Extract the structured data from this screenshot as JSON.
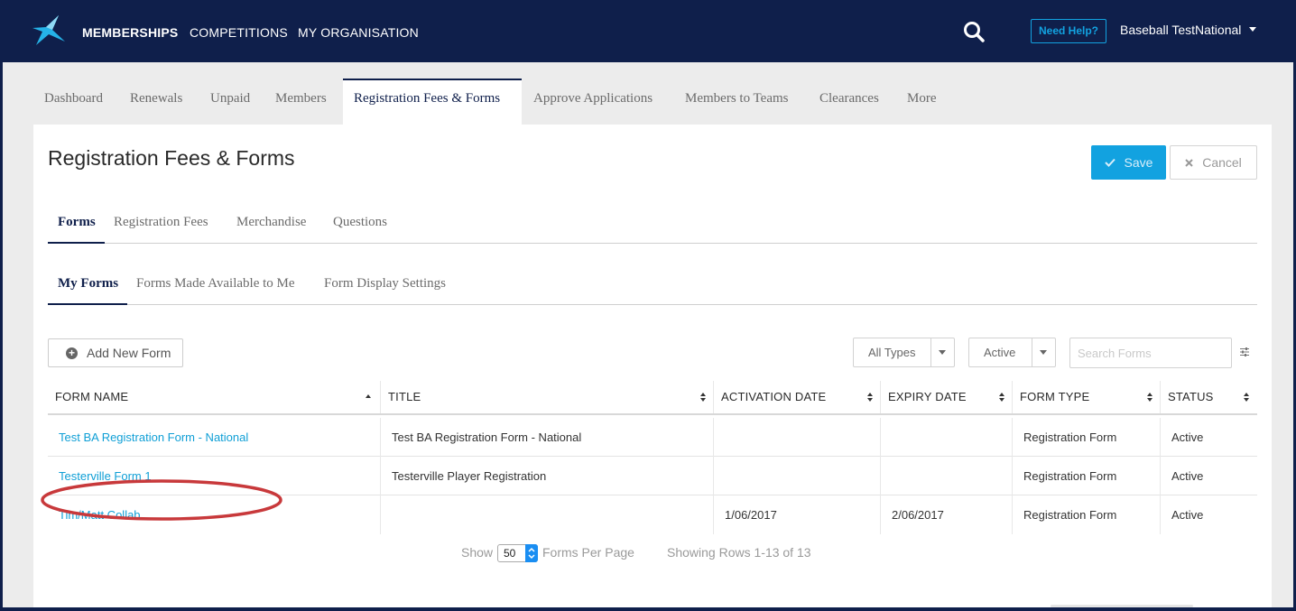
{
  "topnav": {
    "items": [
      "MEMBERSHIPS",
      "COMPETITIONS",
      "MY ORGANISATION"
    ],
    "help_label": "Need Help?",
    "user_name": "Baseball TestNational"
  },
  "module_tabs": [
    "Dashboard",
    "Renewals",
    "Unpaid",
    "Members",
    "Registration Fees & Forms",
    "Approve Applications",
    "Members to Teams",
    "Clearances",
    "More"
  ],
  "page": {
    "title": "Registration Fees & Forms",
    "save_label": "Save",
    "cancel_label": "Cancel"
  },
  "section_tabs": [
    "Forms",
    "Registration Fees",
    "Merchandise",
    "Questions"
  ],
  "form_tabs": [
    "My Forms",
    "Forms Made Available to Me",
    "Form Display Settings"
  ],
  "toolbar": {
    "add_label": "Add New Form",
    "type_filter": "All Types",
    "status_filter": "Active",
    "search_placeholder": "Search Forms"
  },
  "table": {
    "headers": [
      "FORM NAME",
      "TITLE",
      "ACTIVATION DATE",
      "EXPIRY DATE",
      "FORM TYPE",
      "STATUS"
    ],
    "rows": [
      [
        "Test BA Registration Form - National",
        "Test BA Registration Form - National",
        "",
        "",
        "Registration Form",
        "Active"
      ],
      [
        "Testerville Form 1",
        "Testerville Player Registration",
        "",
        "",
        "Registration Form",
        "Active"
      ],
      [
        "Tim/Matt Collab",
        "",
        "1/06/2017",
        "2/06/2017",
        "Registration Form",
        "Active"
      ]
    ]
  },
  "pagination": {
    "show_label": "Show",
    "per_page": "50",
    "per_page_label": "Forms Per Page",
    "summary": "Showing Rows 1-13 of 13"
  },
  "colors": {
    "navy": "#0f1f4b",
    "accent": "#12a2e0",
    "highlight": "#c8393b"
  }
}
